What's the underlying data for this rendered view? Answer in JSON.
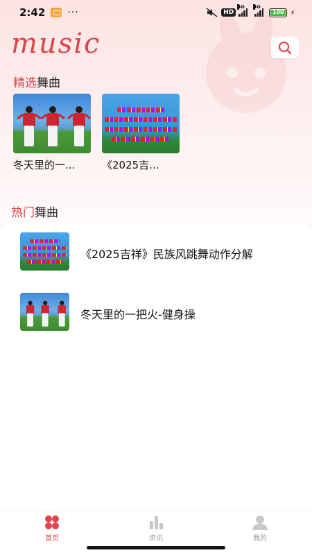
{
  "status_bar": {
    "time": "2:42",
    "dots": "···",
    "hd": "HD",
    "net1": "4G",
    "net2": "4G",
    "battery": "100"
  },
  "header": {
    "logo": "music",
    "search_icon": "search-icon"
  },
  "featured": {
    "title_highlight": "精选",
    "title_rest": "舞曲",
    "items": [
      {
        "title": "冬天里的一...",
        "thumb": "dance-scene"
      },
      {
        "title": "《2025吉...",
        "thumb": "text-scene"
      }
    ]
  },
  "hot": {
    "title_highlight": "热门",
    "title_rest": "舞曲",
    "items": [
      {
        "title": "《2025吉祥》民族风跳舞动作分解",
        "thumb": "text-scene"
      },
      {
        "title": "冬天里的一把火-健身操",
        "thumb": "dance-scene"
      }
    ]
  },
  "tabs": [
    {
      "label": "首页",
      "icon": "home-grid-icon",
      "active": true
    },
    {
      "label": "资讯",
      "icon": "bar-chart-icon",
      "active": false
    },
    {
      "label": "我的",
      "icon": "user-icon",
      "active": false
    }
  ],
  "colors": {
    "accent": "#e0454c",
    "inactive": "#999999"
  }
}
